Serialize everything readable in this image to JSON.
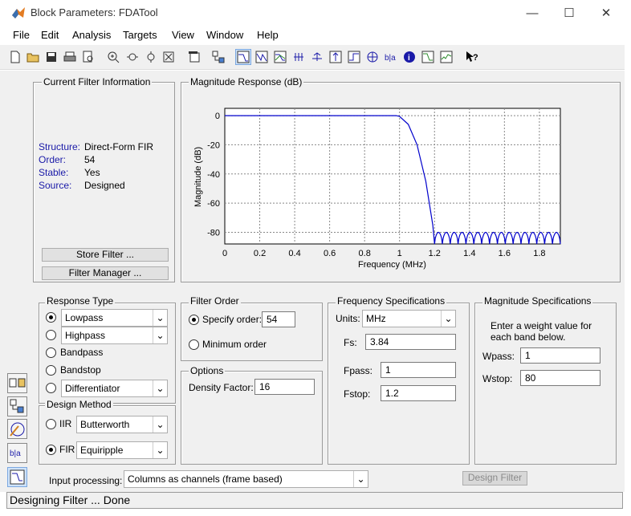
{
  "window": {
    "title": "Block Parameters: FDATool"
  },
  "menu": [
    "File",
    "Edit",
    "Analysis",
    "Targets",
    "View",
    "Window",
    "Help"
  ],
  "current_filter": {
    "title": "Current Filter Information",
    "rows": [
      {
        "label": "Structure:",
        "value": "Direct-Form FIR"
      },
      {
        "label": "Order:",
        "value": "54"
      },
      {
        "label": "Stable:",
        "value": "Yes"
      },
      {
        "label": "Source:",
        "value": "Designed"
      }
    ],
    "store_button": "Store Filter ...",
    "manager_button": "Filter Manager ..."
  },
  "plot": {
    "title": "Magnitude Response (dB)",
    "ylabel": "Magnitude (dB)",
    "xlabel": "Frequency (MHz)",
    "xticks": [
      "0",
      "0.2",
      "0.4",
      "0.6",
      "0.8",
      "1",
      "1.2",
      "1.4",
      "1.6",
      "1.8"
    ],
    "yticks": [
      "0",
      "-20",
      "-40",
      "-60",
      "-80"
    ]
  },
  "chart_data": {
    "type": "line",
    "title": "Magnitude Response (dB)",
    "xlabel": "Frequency (MHz)",
    "ylabel": "Magnitude (dB)",
    "xlim": [
      0,
      1.92
    ],
    "ylim": [
      -88,
      5
    ],
    "grid": true,
    "series": [
      {
        "values_desc": "passband",
        "x": [
          0,
          0.2,
          0.4,
          0.6,
          0.8,
          0.98,
          1.0,
          1.05,
          1.1,
          1.15,
          1.19,
          1.2
        ],
        "y": [
          0,
          0,
          0,
          0,
          0,
          0,
          -0.5,
          -6,
          -20,
          -45,
          -75,
          -88
        ]
      }
    ],
    "stopband_ripple": {
      "x_start": 1.2,
      "x_end": 1.92,
      "peak_db": -80,
      "floor_db": -88,
      "lobes": 16
    }
  },
  "response_type": {
    "title": "Response Type",
    "lowpass": "Lowpass",
    "highpass": "Highpass",
    "bandpass": "Bandpass",
    "bandstop": "Bandstop",
    "differentiator": "Differentiator"
  },
  "design_method": {
    "title": "Design Method",
    "iir_label": "IIR",
    "iir_value": "Butterworth",
    "fir_label": "FIR",
    "fir_value": "Equiripple"
  },
  "filter_order": {
    "title": "Filter Order",
    "specify_label": "Specify order:",
    "specify_value": "54",
    "minimum_label": "Minimum order"
  },
  "options": {
    "title": "Options",
    "density_label": "Density Factor:",
    "density_value": "16"
  },
  "freq_spec": {
    "title": "Frequency Specifications",
    "units_label": "Units:",
    "units_value": "MHz",
    "fs_label": "Fs:",
    "fs_value": "3.84",
    "fpass_label": "Fpass:",
    "fpass_value": "1",
    "fstop_label": "Fstop:",
    "fstop_value": "1.2"
  },
  "mag_spec": {
    "title": "Magnitude Specifications",
    "instr1": "Enter a weight value for",
    "instr2": "each band below.",
    "wpass_label": "Wpass:",
    "wpass_value": "1",
    "wstop_label": "Wstop:",
    "wstop_value": "80"
  },
  "input_processing": {
    "label": "Input processing:",
    "value": "Columns as channels (frame based)"
  },
  "design_button": "Design Filter",
  "status": "Designing Filter ... Done"
}
